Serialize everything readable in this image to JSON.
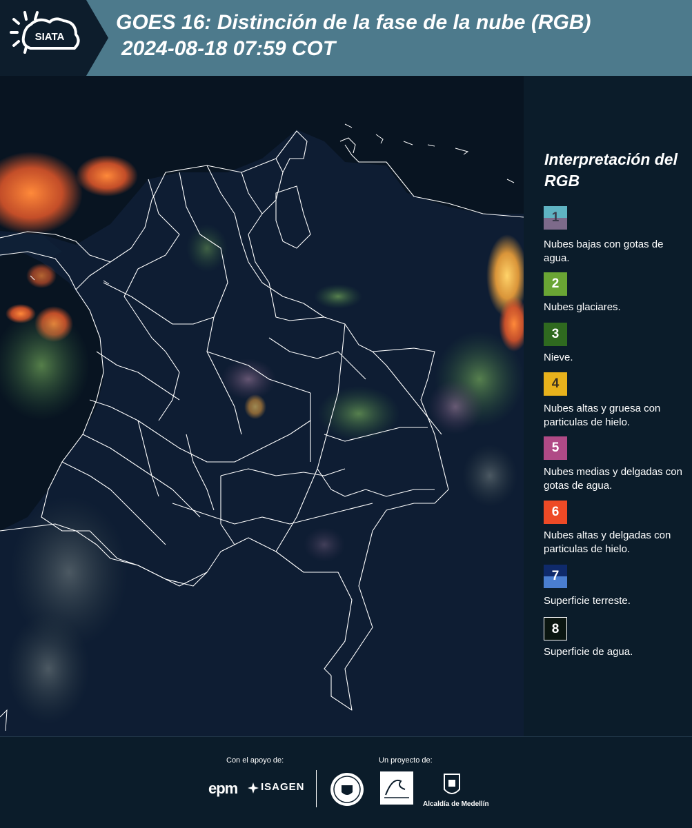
{
  "header": {
    "logo_text": "SIATA",
    "title_line1": "GOES 16: Distinción de la fase de la nube (RGB)",
    "title_line2": "2024-08-18 07:59 COT"
  },
  "legend": {
    "title": "Interpretación del RGB",
    "items": [
      {
        "number": "1",
        "label": "Nubes bajas con gotas de agua.",
        "color_top": "#5fb3c2",
        "color_bottom": "#7d6a8a"
      },
      {
        "number": "2",
        "label": "Nubes glaciares.",
        "color_top": "#6aa534",
        "color_bottom": "#6aa534"
      },
      {
        "number": "3",
        "label": "Nieve.",
        "color_top": "#2f6a1f",
        "color_bottom": "#2f6a1f"
      },
      {
        "number": "4",
        "label": "Nubes altas y gruesa con particulas de hielo.",
        "color_top": "#e8b21c",
        "color_bottom": "#e8b21c"
      },
      {
        "number": "5",
        "label": "Nubes medias y delgadas con gotas de agua.",
        "color_top": "#b04a86",
        "color_bottom": "#b04a86"
      },
      {
        "number": "6",
        "label": "Nubes altas y delgadas con particulas de hielo.",
        "color_top": "#ee4a26",
        "color_bottom": "#ee4a26"
      },
      {
        "number": "7",
        "label": "Superficie terreste.",
        "color_top": "#0f2a6b",
        "color_bottom": "#4a7ed0"
      },
      {
        "number": "8",
        "label": "Superficie de agua.",
        "color_top": "#0a1510",
        "color_bottom": "#0a1510"
      }
    ]
  },
  "footer": {
    "support_label": "Con el apoyo de:",
    "project_label": "Un proyecto de:",
    "sponsor_1": "epm",
    "sponsor_2": "ISAGEN",
    "partner_alcaldia": "Alcaldía de Medellín"
  },
  "colors": {
    "header_bg": "#4d7a8c",
    "panel_bg": "#0b1c2a",
    "water": "#081421",
    "land": "#0e1d33"
  }
}
